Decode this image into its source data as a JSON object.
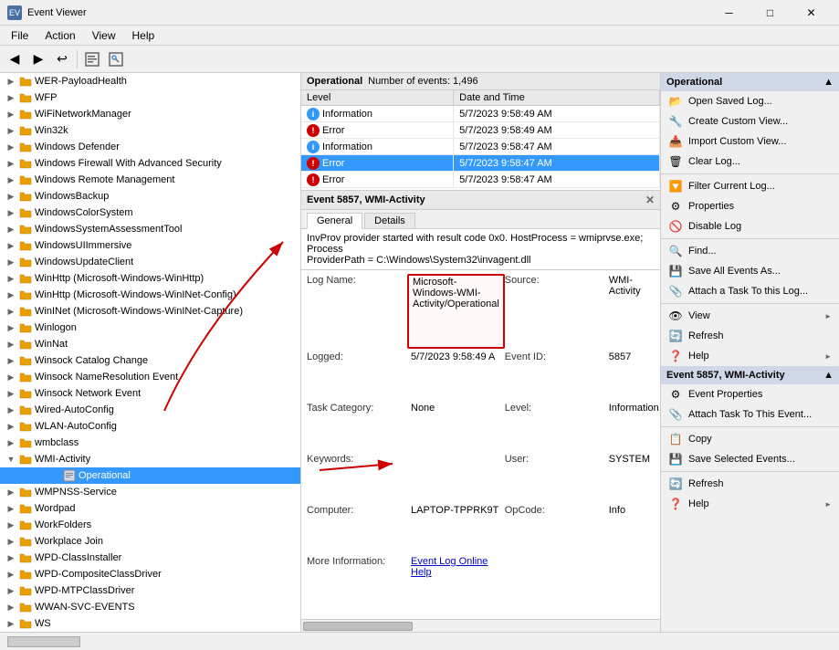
{
  "titleBar": {
    "icon": "📋",
    "title": "Event Viewer",
    "minBtn": "─",
    "maxBtn": "□",
    "closeBtn": "✕"
  },
  "menuBar": {
    "items": [
      "File",
      "Action",
      "View",
      "Help"
    ]
  },
  "toolbar": {
    "buttons": [
      "◀",
      "▶",
      "↩",
      "🖼",
      "🖼"
    ]
  },
  "treePanel": {
    "items": [
      {
        "label": "WER-PayloadHealth",
        "indent": 2,
        "hasExpand": true,
        "expanded": false
      },
      {
        "label": "WFP",
        "indent": 2,
        "hasExpand": true,
        "expanded": false
      },
      {
        "label": "WiFiNetworkManager",
        "indent": 2,
        "hasExpand": true,
        "expanded": false
      },
      {
        "label": "Win32k",
        "indent": 2,
        "hasExpand": true,
        "expanded": false
      },
      {
        "label": "Windows Defender",
        "indent": 2,
        "hasExpand": true,
        "expanded": false
      },
      {
        "label": "Windows Firewall With Advanced Security",
        "indent": 2,
        "hasExpand": true,
        "expanded": false
      },
      {
        "label": "Windows Remote Management",
        "indent": 2,
        "hasExpand": true,
        "expanded": false
      },
      {
        "label": "WindowsBackup",
        "indent": 2,
        "hasExpand": true,
        "expanded": false
      },
      {
        "label": "WindowsColorSystem",
        "indent": 2,
        "hasExpand": true,
        "expanded": false
      },
      {
        "label": "WindowsSystemAssessmentTool",
        "indent": 2,
        "hasExpand": true,
        "expanded": false
      },
      {
        "label": "WindowsUIImmersive",
        "indent": 2,
        "hasExpand": true,
        "expanded": false
      },
      {
        "label": "WindowsUpdateClient",
        "indent": 2,
        "hasExpand": true,
        "expanded": false
      },
      {
        "label": "WinHttp (Microsoft-Windows-WinHttp)",
        "indent": 2,
        "hasExpand": true,
        "expanded": false
      },
      {
        "label": "WinHttp (Microsoft-Windows-WinINet-Config)",
        "indent": 2,
        "hasExpand": true,
        "expanded": false
      },
      {
        "label": "WinINet (Microsoft-Windows-WinINet-Capture)",
        "indent": 2,
        "hasExpand": true,
        "expanded": false
      },
      {
        "label": "Winlogon",
        "indent": 2,
        "hasExpand": true,
        "expanded": false
      },
      {
        "label": "WinNat",
        "indent": 2,
        "hasExpand": true,
        "expanded": false
      },
      {
        "label": "Winsock Catalog Change",
        "indent": 2,
        "hasExpand": true,
        "expanded": false
      },
      {
        "label": "Winsock NameResolution Event",
        "indent": 2,
        "hasExpand": true,
        "expanded": false
      },
      {
        "label": "Winsock Network Event",
        "indent": 2,
        "hasExpand": true,
        "expanded": false
      },
      {
        "label": "Wired-AutoConfig",
        "indent": 2,
        "hasExpand": true,
        "expanded": false
      },
      {
        "label": "WLAN-AutoConfig",
        "indent": 2,
        "hasExpand": true,
        "expanded": false
      },
      {
        "label": "wmbclass",
        "indent": 2,
        "hasExpand": true,
        "expanded": false
      },
      {
        "label": "WMI-Activity",
        "indent": 2,
        "hasExpand": true,
        "expanded": true
      },
      {
        "label": "Operational",
        "indent": 3,
        "selected": true
      },
      {
        "label": "WMPNSS-Service",
        "indent": 2,
        "hasExpand": true,
        "expanded": false
      },
      {
        "label": "Wordpad",
        "indent": 2,
        "hasExpand": true,
        "expanded": false
      },
      {
        "label": "WorkFolders",
        "indent": 2,
        "hasExpand": true,
        "expanded": false
      },
      {
        "label": "Workplace Join",
        "indent": 2,
        "hasExpand": true,
        "expanded": false
      },
      {
        "label": "WPD-ClassInstaller",
        "indent": 2,
        "hasExpand": true,
        "expanded": false
      },
      {
        "label": "WPD-CompositeClassDriver",
        "indent": 2,
        "hasExpand": true,
        "expanded": false
      },
      {
        "label": "WPD-MTPClassDriver",
        "indent": 2,
        "hasExpand": true,
        "expanded": false
      },
      {
        "label": "WWAN-SVC-EVENTS",
        "indent": 2,
        "hasExpand": true,
        "expanded": false
      },
      {
        "label": "WS",
        "indent": 2,
        "hasExpand": true,
        "expanded": false
      }
    ]
  },
  "eventsPanel": {
    "title": "Operational",
    "countLabel": "Number of events: 1,496",
    "columns": [
      "Level",
      "Date and Time"
    ],
    "events": [
      {
        "level": "Information",
        "levelType": "info",
        "dateTime": "5/7/2023 9:58:49 AM",
        "selected": false
      },
      {
        "level": "Error",
        "levelType": "error",
        "dateTime": "5/7/2023 9:58:49 AM",
        "selected": false
      },
      {
        "level": "Information",
        "levelType": "info",
        "dateTime": "5/7/2023 9:58:47 AM",
        "selected": false
      },
      {
        "level": "Error",
        "levelType": "error",
        "dateTime": "5/7/2023 9:58:47 AM",
        "selected": true
      },
      {
        "level": "Error",
        "levelType": "error",
        "dateTime": "5/7/2023 9:58:47 AM",
        "selected": false
      }
    ]
  },
  "eventDetail": {
    "header": "Event 5857, WMI-Activity",
    "closeBtn": "✕",
    "tabs": [
      "General",
      "Details"
    ],
    "activeTab": "General",
    "description": "InvProv provider started with result code 0x0. HostProcess = wmiprvse.exe; Process\nProviderPath = C:\\Windows\\System32\\invagent.dll",
    "properties": {
      "logName": {
        "label": "Log Name:",
        "value": "Microsoft-Windows-WMI-Activity/Operational",
        "highlighted": true
      },
      "source": {
        "label": "Source:",
        "value": "WMI-Activity"
      },
      "logged": {
        "label": "Logged:",
        "value": "5/7/2023 9:58:49 A"
      },
      "eventId": {
        "label": "Event ID:",
        "value": "5857"
      },
      "taskCategory": {
        "label": "Task Category:",
        "value": "None"
      },
      "level": {
        "label": "Level:",
        "value": "Information"
      },
      "keywords": {
        "label": "Keywords:",
        "value": ""
      },
      "user": {
        "label": "User:",
        "value": "SYSTEM"
      },
      "computer": {
        "label": "Computer:",
        "value": "LAPTOP-TPPRK9T"
      },
      "opCode": {
        "label": "OpCode:",
        "value": "Info"
      },
      "moreInfo": {
        "label": "More Information:",
        "value": "Event Log Online Help",
        "isLink": true
      }
    }
  },
  "actionsPanel": {
    "sections": [
      {
        "title": "Operational",
        "items": [
          {
            "label": "Open Saved Log...",
            "icon": "📂"
          },
          {
            "label": "Create Custom View...",
            "icon": "🔧"
          },
          {
            "label": "Import Custom View...",
            "icon": "📥"
          },
          {
            "label": "Clear Log...",
            "icon": "🗑"
          },
          {
            "divider": true
          },
          {
            "label": "Filter Current Log...",
            "icon": "🔽"
          },
          {
            "label": "Properties",
            "icon": "⚙"
          },
          {
            "label": "Disable Log",
            "icon": "🚫"
          },
          {
            "divider": true
          },
          {
            "label": "Find...",
            "icon": "🔍"
          },
          {
            "label": "Save All Events As...",
            "icon": "💾"
          },
          {
            "label": "Attach a Task To this Log...",
            "icon": "📎"
          },
          {
            "divider": true
          },
          {
            "label": "View",
            "icon": "👁",
            "hasSubmenu": true
          },
          {
            "label": "Refresh",
            "icon": "🔄"
          },
          {
            "label": "Help",
            "icon": "❓",
            "hasSubmenu": true
          }
        ]
      },
      {
        "title": "Event 5857, WMI-Activity",
        "items": [
          {
            "label": "Event Properties",
            "icon": "⚙"
          },
          {
            "label": "Attach Task To This Event...",
            "icon": "📎"
          },
          {
            "divider": true
          },
          {
            "label": "Copy",
            "icon": "📋"
          },
          {
            "label": "Save Selected Events...",
            "icon": "💾"
          },
          {
            "divider": true
          },
          {
            "label": "Refresh",
            "icon": "🔄"
          },
          {
            "label": "Help",
            "icon": "❓",
            "hasSubmenu": true
          }
        ]
      }
    ]
  }
}
